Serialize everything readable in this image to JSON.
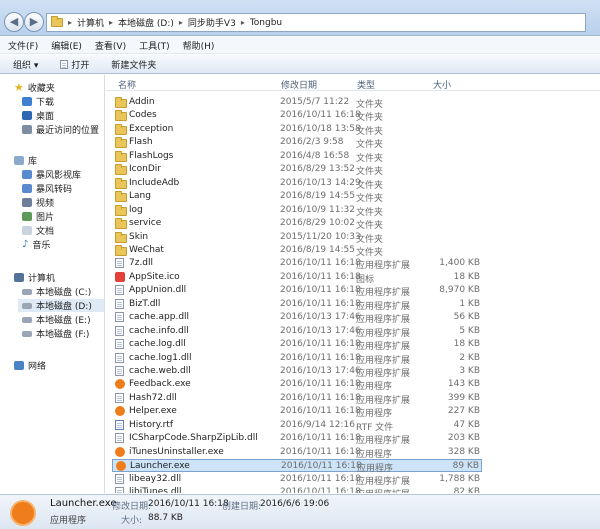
{
  "address": {
    "parts": [
      "计算机",
      "本地磁盘 (D:)",
      "同步助手V3",
      "Tongbu"
    ]
  },
  "menu": [
    "文件(F)",
    "编辑(E)",
    "查看(V)",
    "工具(T)",
    "帮助(H)"
  ],
  "toolbar": {
    "organize": "组织 ▾",
    "open": "打开",
    "new_folder": "新建文件夹"
  },
  "sidebar": {
    "favorites": "收藏夹",
    "fav_items": [
      "下载",
      "桌面",
      "最近访问的位置"
    ],
    "libraries": "库",
    "lib_items": [
      "暴风影视库",
      "暴风转码",
      "视频",
      "图片",
      "文档",
      "音乐"
    ],
    "computer": "计算机",
    "drives": [
      "本地磁盘 (C:)",
      "本地磁盘 (D:)",
      "本地磁盘 (E:)",
      "本地磁盘 (F:)"
    ],
    "network": "网络"
  },
  "columns": {
    "name": "名称",
    "date": "修改日期",
    "type": "类型",
    "size": "大小"
  },
  "files": [
    {
      "name": "Addin",
      "date": "2015/5/7 11:22",
      "type": "文件夹",
      "size": ""
    },
    {
      "name": "Codes",
      "date": "2016/10/11 16:18",
      "type": "文件夹",
      "size": ""
    },
    {
      "name": "Exception",
      "date": "2016/10/18 13:58",
      "type": "文件夹",
      "size": ""
    },
    {
      "name": "Flash",
      "date": "2016/2/3 9:58",
      "type": "文件夹",
      "size": ""
    },
    {
      "name": "FlashLogs",
      "date": "2016/4/8 16:58",
      "type": "文件夹",
      "size": ""
    },
    {
      "name": "IconDir",
      "date": "2016/8/29 13:52",
      "type": "文件夹",
      "size": ""
    },
    {
      "name": "IncludeAdb",
      "date": "2016/10/13 14:29",
      "type": "文件夹",
      "size": ""
    },
    {
      "name": "Lang",
      "date": "2016/8/19 14:55",
      "type": "文件夹",
      "size": ""
    },
    {
      "name": "log",
      "date": "2016/10/9 11:32",
      "type": "文件夹",
      "size": ""
    },
    {
      "name": "service",
      "date": "2016/8/29 10:02",
      "type": "文件夹",
      "size": ""
    },
    {
      "name": "Skin",
      "date": "2015/11/20 10:33",
      "type": "文件夹",
      "size": ""
    },
    {
      "name": "WeChat",
      "date": "2016/8/19 14:55",
      "type": "文件夹",
      "size": ""
    },
    {
      "name": "7z.dll",
      "date": "2016/10/11 16:18",
      "type": "应用程序扩展",
      "size": "1,400 KB"
    },
    {
      "name": "AppSite.ico",
      "date": "2016/10/11 16:18",
      "type": "图标",
      "size": "18 KB"
    },
    {
      "name": "AppUnion.dll",
      "date": "2016/10/11 16:18",
      "type": "应用程序扩展",
      "size": "8,970 KB"
    },
    {
      "name": "BizT.dll",
      "date": "2016/10/11 16:18",
      "type": "应用程序扩展",
      "size": "1 KB"
    },
    {
      "name": "cache.app.dll",
      "date": "2016/10/13 17:46",
      "type": "应用程序扩展",
      "size": "56 KB"
    },
    {
      "name": "cache.info.dll",
      "date": "2016/10/13 17:46",
      "type": "应用程序扩展",
      "size": "5 KB"
    },
    {
      "name": "cache.log.dll",
      "date": "2016/10/11 16:18",
      "type": "应用程序扩展",
      "size": "18 KB"
    },
    {
      "name": "cache.log1.dll",
      "date": "2016/10/11 16:18",
      "type": "应用程序扩展",
      "size": "2 KB"
    },
    {
      "name": "cache.web.dll",
      "date": "2016/10/13 17:46",
      "type": "应用程序扩展",
      "size": "3 KB"
    },
    {
      "name": "Feedback.exe",
      "date": "2016/10/11 16:18",
      "type": "应用程序",
      "size": "143 KB"
    },
    {
      "name": "Hash72.dll",
      "date": "2016/10/11 16:18",
      "type": "应用程序扩展",
      "size": "399 KB"
    },
    {
      "name": "Helper.exe",
      "date": "2016/10/11 16:18",
      "type": "应用程序",
      "size": "227 KB"
    },
    {
      "name": "History.rtf",
      "date": "2016/9/14 12:16",
      "type": "RTF 文件",
      "size": "47 KB"
    },
    {
      "name": "ICSharpCode.SharpZipLib.dll",
      "date": "2016/10/11 16:18",
      "type": "应用程序扩展",
      "size": "203 KB"
    },
    {
      "name": "iTunesUninstaller.exe",
      "date": "2016/10/11 16:18",
      "type": "应用程序",
      "size": "328 KB"
    },
    {
      "name": "Launcher.exe",
      "date": "2016/10/11 16:18",
      "type": "应用程序",
      "size": "89 KB"
    },
    {
      "name": "libeay32.dll",
      "date": "2016/10/11 16:18",
      "type": "应用程序扩展",
      "size": "1,788 KB"
    },
    {
      "name": "libiTunes.dll",
      "date": "2016/10/11 16:18",
      "type": "应用程序扩展",
      "size": "82 KB"
    }
  ],
  "details": {
    "name": "Launcher.exe",
    "modified_label": "修改日期:",
    "modified": "2016/10/11 16:18",
    "created_label": "创建日期:",
    "created": "2016/6/6 19:06",
    "type": "应用程序",
    "size_label": "大小:",
    "size": "88.7 KB"
  },
  "colors": {
    "selection": "#cde3f7",
    "folder": "#e9c55a",
    "exe_orange": "#f07d1c"
  }
}
